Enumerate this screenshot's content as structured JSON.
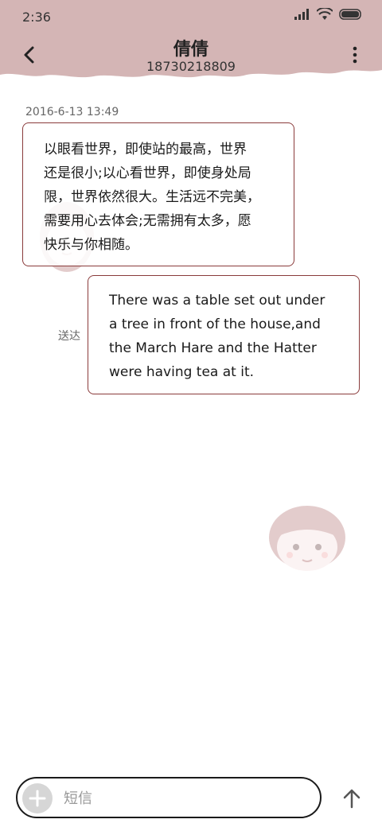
{
  "status_bar": {
    "time": "2:36"
  },
  "header": {
    "contact_name": "倩倩",
    "contact_number": "18730218809",
    "background_color": "#d4b5b5"
  },
  "conversation": {
    "timestamp": "2016-6-13 13:49",
    "messages": [
      {
        "direction": "incoming",
        "text": "以眼看世界，即使站的最高，世界\n还是很小;以心看世界，即使身处局\n限，世界依然很大。生活远不完美，\n需要用心去体会;无需拥有太多，愿\n快乐与你相随。"
      },
      {
        "direction": "outgoing",
        "text": "There was a table set out under\na tree in front of the house,and\nthe March Hare and the Hatter\nwere having tea at it.",
        "status": "送达"
      }
    ],
    "bubble_border_color": "#8a3b3b"
  },
  "compose": {
    "placeholder": "短信"
  }
}
